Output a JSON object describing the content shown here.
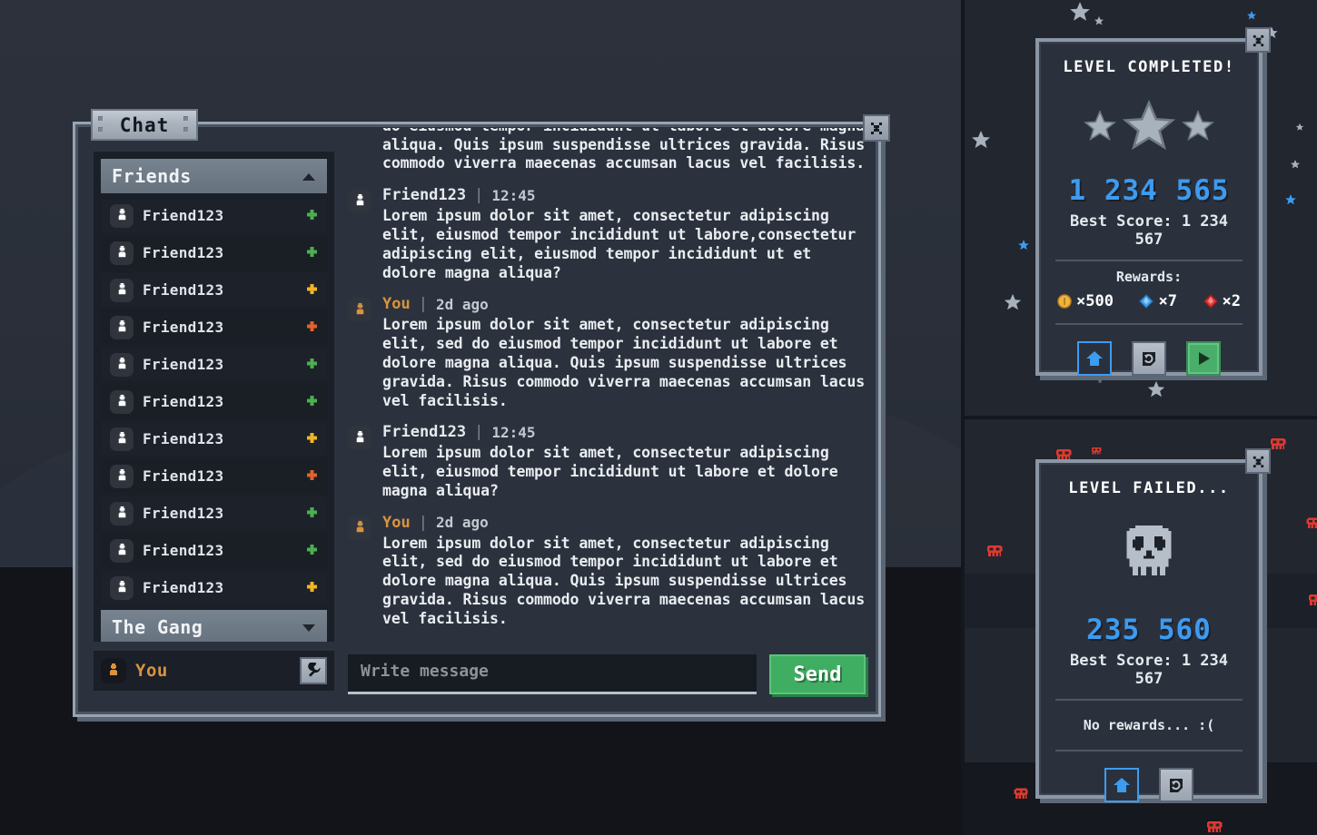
{
  "chat_window": {
    "tab_label": "Chat",
    "close_icon": "close-x-icon",
    "friends_panel": {
      "groups": [
        {
          "label": "Friends",
          "expanded": true,
          "chevron": "chevron-up-icon"
        },
        {
          "label": "The Gang",
          "expanded": false,
          "chevron": "chevron-down-icon"
        }
      ],
      "friends": [
        {
          "name": "Friend123",
          "status": "online",
          "color": "#4caf50"
        },
        {
          "name": "Friend123",
          "status": "online",
          "color": "#4caf50"
        },
        {
          "name": "Friend123",
          "status": "away",
          "color": "#f0b429"
        },
        {
          "name": "Friend123",
          "status": "busy",
          "color": "#e0622c"
        },
        {
          "name": "Friend123",
          "status": "online",
          "color": "#4caf50"
        },
        {
          "name": "Friend123",
          "status": "online",
          "color": "#4caf50"
        },
        {
          "name": "Friend123",
          "status": "away",
          "color": "#f0b429"
        },
        {
          "name": "Friend123",
          "status": "busy",
          "color": "#e0622c"
        },
        {
          "name": "Friend123",
          "status": "online",
          "color": "#4caf50"
        },
        {
          "name": "Friend123",
          "status": "online",
          "color": "#4caf50"
        },
        {
          "name": "Friend123",
          "status": "away",
          "color": "#f0b429"
        }
      ]
    },
    "me_bar": {
      "label": "You",
      "avatar_icon": "user-avatar-icon",
      "settings_icon": "wrench-icon"
    },
    "messages": [
      {
        "author": "",
        "time": "",
        "continued": true,
        "is_me": false,
        "text": "amet, consectetur adipiscing elit, sed do eiusmod tempor incididunt ut labore et dolore magna aliqua. Quis ipsum suspendisse ultrices gravida. Risus commodo viverra maecenas accumsan lacus vel facilisis. Lorem ipsum dolor sit amet, consectetur adipiscing elit, sed do eiusmod tempor incididunt ut labore et dolore magna aliqua. Quis ipsum suspendisse ultrices gravida. Risus commodo viverra maecenas accumsan lacus vel facilisis."
      },
      {
        "author": "Friend123",
        "time": "12:45",
        "continued": false,
        "is_me": false,
        "text": "Lorem ipsum dolor sit amet, consectetur adipiscing elit, eiusmod tempor incididunt ut labore,consectetur adipiscing elit, eiusmod tempor incididunt ut et dolore magna aliqua?"
      },
      {
        "author": "You",
        "time": "2d ago",
        "continued": false,
        "is_me": true,
        "text": "Lorem ipsum dolor sit amet, consectetur adipiscing elit, sed do eiusmod tempor incididunt ut labore et dolore magna aliqua. Quis ipsum suspendisse ultrices gravida. Risus commodo viverra maecenas accumsan lacus vel facilisis."
      },
      {
        "author": "Friend123",
        "time": "12:45",
        "continued": false,
        "is_me": false,
        "text": "Lorem ipsum dolor sit amet, consectetur adipiscing elit, eiusmod tempor incididunt ut labore et dolore magna aliqua?"
      },
      {
        "author": "You",
        "time": "2d ago",
        "continued": false,
        "is_me": true,
        "text": "Lorem ipsum dolor sit amet, consectetur adipiscing elit, sed do eiusmod tempor incididunt ut labore et dolore magna aliqua. Quis ipsum suspendisse ultrices gravida. Risus commodo viverra maecenas accumsan lacus vel facilisis."
      }
    ],
    "composer": {
      "placeholder": "Write message",
      "value": "",
      "send_label": "Send"
    }
  },
  "panel_completed": {
    "title": "LEVEL COMPLETED!",
    "close_icon": "close-x-icon",
    "stars": {
      "count": 3,
      "filled": 3,
      "icon": "star-icon"
    },
    "score": "1 234 565",
    "best_score": "Best Score: 1 234 567",
    "rewards_label": "Rewards:",
    "rewards": [
      {
        "icon": "coin-icon",
        "amount": "×500",
        "color": "#f2b33d"
      },
      {
        "icon": "blue-gem-icon",
        "amount": "×7",
        "color": "#4aa3ef"
      },
      {
        "icon": "red-gem-icon",
        "amount": "×2",
        "color": "#e03a3a"
      }
    ],
    "buttons": [
      {
        "name": "home-button",
        "icon": "home-icon",
        "style": "home"
      },
      {
        "name": "restart-button",
        "icon": "restart-icon",
        "style": "restart"
      },
      {
        "name": "play-button",
        "icon": "play-icon",
        "style": "play"
      }
    ]
  },
  "panel_failed": {
    "title": "LEVEL FAILED...",
    "close_icon": "close-x-icon",
    "skull_icon": "sad-skull-icon",
    "score": "235 560",
    "best_score": "Best Score: 1 234 567",
    "no_rewards": "No rewards... :(",
    "buttons": [
      {
        "name": "home-button",
        "icon": "home-icon",
        "style": "home"
      },
      {
        "name": "restart-button",
        "icon": "restart-icon",
        "style": "restart"
      }
    ]
  },
  "theme": {
    "bg_dark": "#22262f",
    "panel_bg": "#2b313c",
    "frame_light": "#8c97a6",
    "accent_blue": "#3d9bf0",
    "accent_green": "#3fae63",
    "accent_orange": "#d8943f",
    "star_gray": "#a8b2bd",
    "skull_red": "#e0392f"
  }
}
